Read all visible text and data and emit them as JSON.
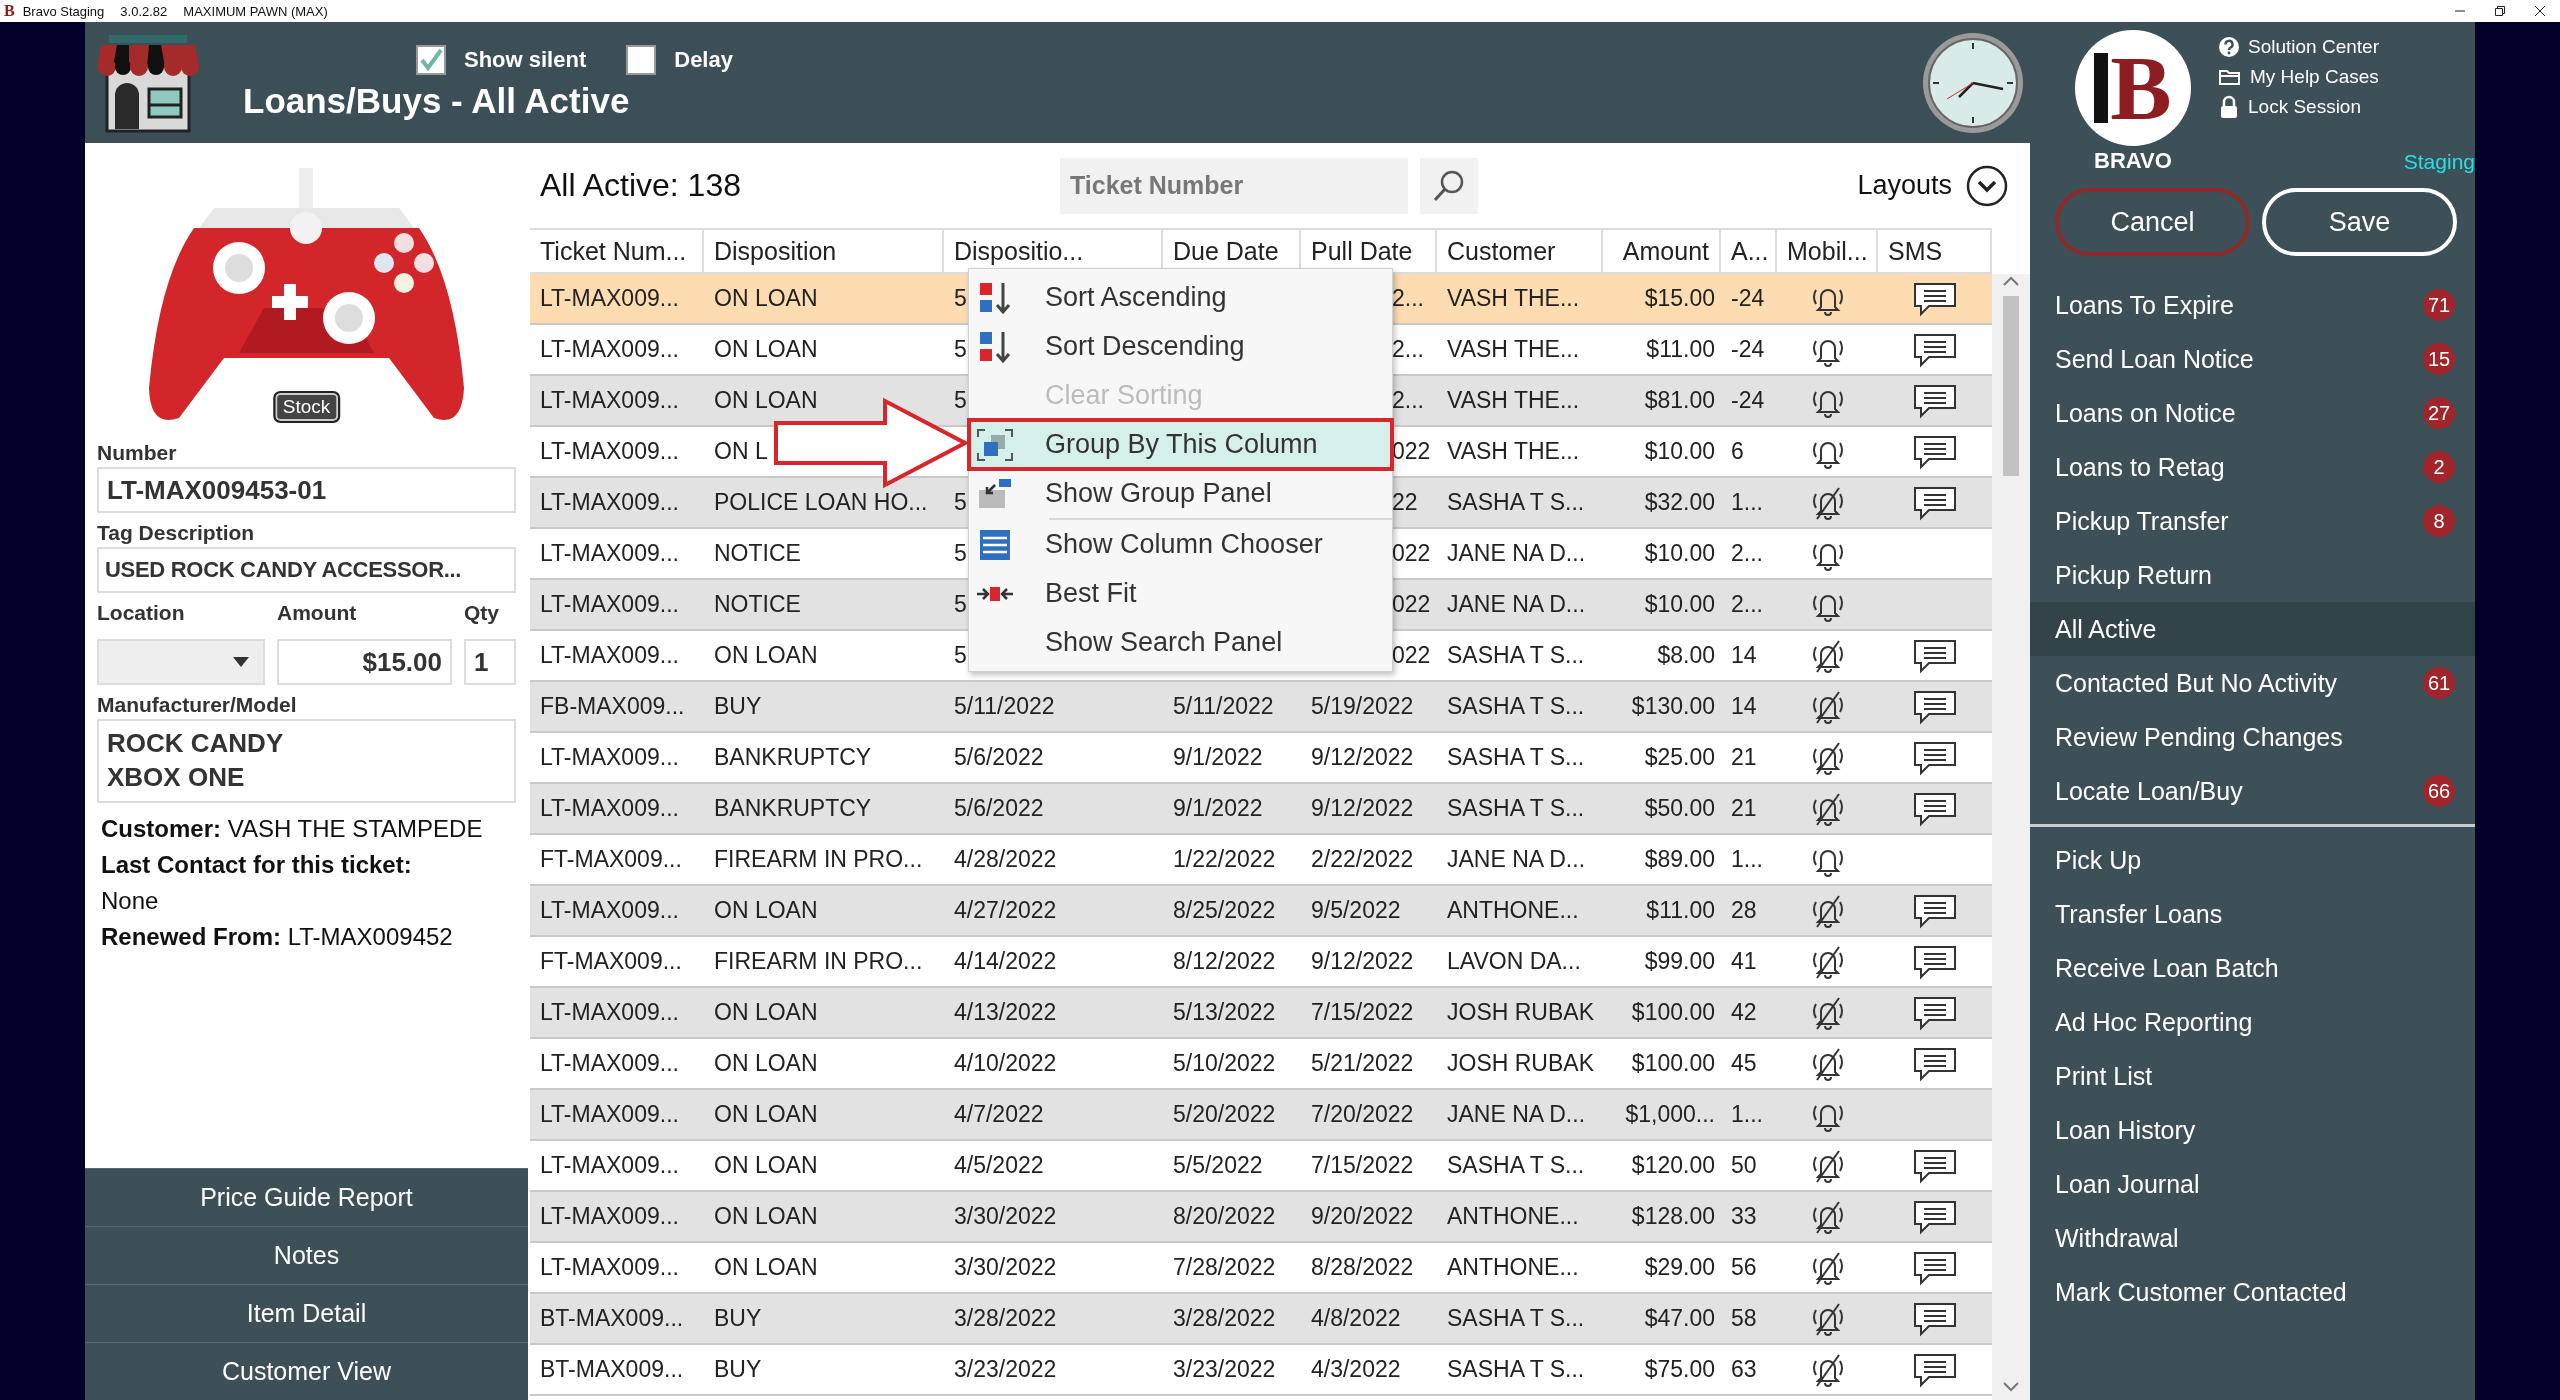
{
  "window": {
    "app_mark": "B",
    "title": "Bravo Staging",
    "version": "3.0.2.82",
    "store": "MAXIMUM PAWN (MAX)"
  },
  "header": {
    "options": [
      {
        "label": "Show silent",
        "checked": true
      },
      {
        "label": "Delay",
        "checked": false
      }
    ],
    "title": "Loans/Buys - All Active"
  },
  "brand": {
    "mark": "B",
    "name": "BRAVO",
    "environment": "Staging"
  },
  "help_links": [
    {
      "label": "Solution Center",
      "kind": "help"
    },
    {
      "label": "My Help Cases",
      "kind": "folder"
    },
    {
      "label": "Lock Session",
      "kind": "lock"
    }
  ],
  "actions": [
    {
      "label": "Cancel",
      "kind": "cancel"
    },
    {
      "label": "Save",
      "kind": "save"
    }
  ],
  "sidebar": {
    "sections": [
      {
        "items": [
          {
            "label": "Loans To Expire",
            "badge": "71",
            "selected": false
          },
          {
            "label": "Send Loan Notice",
            "badge": "15",
            "selected": false
          },
          {
            "label": "Loans on Notice",
            "badge": "27",
            "selected": false
          },
          {
            "label": "Loans to Retag",
            "badge": "2",
            "selected": false
          },
          {
            "label": "Pickup Transfer",
            "badge": "8",
            "selected": false
          },
          {
            "label": "Pickup Return",
            "selected": false
          },
          {
            "label": "All Active",
            "selected": true
          },
          {
            "label": "Contacted But No Activity",
            "badge": "61",
            "selected": false
          },
          {
            "label": "Review Pending Changes",
            "selected": false
          },
          {
            "label": "Locate Loan/Buy",
            "badge": "66",
            "selected": false
          }
        ]
      },
      {
        "items": [
          {
            "label": "Pick Up",
            "selected": false
          },
          {
            "label": "Transfer Loans",
            "selected": false
          },
          {
            "label": "Receive Loan Batch",
            "selected": false
          },
          {
            "label": "Ad Hoc Reporting",
            "selected": false
          },
          {
            "label": "Print List",
            "selected": false
          },
          {
            "label": "Loan History",
            "selected": false
          },
          {
            "label": "Loan Journal",
            "selected": false
          },
          {
            "label": "Withdrawal",
            "selected": false
          },
          {
            "label": "Mark Customer Contacted",
            "selected": false
          }
        ]
      }
    ]
  },
  "item": {
    "stock_badge": "Stock",
    "number": {
      "label": "Number",
      "value": "LT-MAX009453-01"
    },
    "tag_description": {
      "label": "Tag Description",
      "value": "USED ROCK CANDY ACCESSOR..."
    },
    "location": {
      "label": "Location"
    },
    "amount": {
      "label": "Amount",
      "value": "$15.00"
    },
    "qty": {
      "label": "Qty",
      "value": "1"
    },
    "manufacturer_model": {
      "label": "Manufacturer/Model",
      "value": "ROCK CANDY\nXBOX ONE"
    },
    "info": [
      {
        "text": "**Customer:** VASH THE STAMPEDE",
        "bold": false
      },
      {
        "text": "Last Contact for this ticket:",
        "bold": true
      },
      {
        "text": "None",
        "bold": false
      },
      {
        "text": "**Renewed From:** LT-MAX009452",
        "bold": false
      }
    ]
  },
  "left_buttons": [
    "Price Guide Report",
    "Notes",
    "Item Detail",
    "Customer View"
  ],
  "list": {
    "heading": "All Active: 138",
    "search": {
      "placeholder": "Ticket Number"
    },
    "layouts": "Layouts",
    "columns": [
      "Ticket Num...",
      "Disposition",
      "Dispositio...",
      "Due Date",
      "Pull Date",
      "Customer",
      "Amount",
      "A...",
      "Mobil...",
      "SMS"
    ],
    "rows": [
      {
        "ticket": "LT-MAX009...",
        "disposition": "ON LOAN",
        "disposition_date": "5",
        "pull_date": "2...",
        "customer": "VASH THE...",
        "amount": "$15.00",
        "column_8": "-24",
        "muted": false,
        "sms": true,
        "selected": true
      },
      {
        "ticket": "LT-MAX009...",
        "disposition": "ON LOAN",
        "disposition_date": "5",
        "pull_date": "2...",
        "customer": "VASH THE...",
        "amount": "$11.00",
        "column_8": "-24",
        "muted": false,
        "sms": true,
        "selected": false
      },
      {
        "ticket": "LT-MAX009...",
        "disposition": "ON LOAN",
        "disposition_date": "5",
        "pull_date": "2...",
        "customer": "VASH THE...",
        "amount": "$81.00",
        "column_8": "-24",
        "muted": false,
        "sms": true,
        "selected": false
      },
      {
        "ticket": "LT-MAX009...",
        "disposition": "ON L",
        "pull_date": "022",
        "customer": "VASH THE...",
        "amount": "$10.00",
        "column_8": "6",
        "muted": false,
        "sms": true,
        "selected": false
      },
      {
        "ticket": "LT-MAX009...",
        "disposition": "POLICE LOAN HO...",
        "disposition_date": "5",
        "pull_date": "22",
        "customer": "SASHA T S...",
        "amount": "$32.00",
        "column_8": "1...",
        "muted": true,
        "sms": true,
        "selected": false
      },
      {
        "ticket": "LT-MAX009...",
        "disposition": "NOTICE",
        "disposition_date": "5",
        "pull_date": "022",
        "customer": "JANE NA D...",
        "amount": "$10.00",
        "column_8": "2...",
        "muted": false,
        "sms": false,
        "selected": false
      },
      {
        "ticket": "LT-MAX009...",
        "disposition": "NOTICE",
        "disposition_date": "5",
        "pull_date": "022",
        "customer": "JANE NA D...",
        "amount": "$10.00",
        "column_8": "2...",
        "muted": false,
        "sms": false,
        "selected": false
      },
      {
        "ticket": "LT-MAX009...",
        "disposition": "ON LOAN",
        "disposition_date": "5",
        "pull_date": "022",
        "customer": "SASHA T S...",
        "amount": "$8.00",
        "column_8": "14",
        "muted": true,
        "sms": true,
        "selected": false
      },
      {
        "ticket": "FB-MAX009...",
        "disposition": "BUY",
        "disposition_date": "5/11/2022",
        "due_date": "5/11/2022",
        "pull_date": "5/19/2022",
        "customer": "SASHA T S...",
        "amount": "$130.00",
        "column_8": "14",
        "muted": true,
        "sms": true,
        "selected": false
      },
      {
        "ticket": "LT-MAX009...",
        "disposition": "BANKRUPTCY",
        "disposition_date": "5/6/2022",
        "due_date": "9/1/2022",
        "pull_date": "9/12/2022",
        "customer": "SASHA T S...",
        "amount": "$25.00",
        "column_8": "21",
        "muted": true,
        "sms": true,
        "selected": false
      },
      {
        "ticket": "LT-MAX009...",
        "disposition": "BANKRUPTCY",
        "disposition_date": "5/6/2022",
        "due_date": "9/1/2022",
        "pull_date": "9/12/2022",
        "customer": "SASHA T S...",
        "amount": "$50.00",
        "column_8": "21",
        "muted": true,
        "sms": true,
        "selected": false
      },
      {
        "ticket": "FT-MAX009...",
        "disposition": "FIREARM IN PRO...",
        "disposition_date": "4/28/2022",
        "due_date": "1/22/2022",
        "pull_date": "2/22/2022",
        "customer": "JANE NA D...",
        "amount": "$89.00",
        "column_8": "1...",
        "muted": false,
        "sms": false,
        "selected": false
      },
      {
        "ticket": "LT-MAX009...",
        "disposition": "ON LOAN",
        "disposition_date": "4/27/2022",
        "due_date": "8/25/2022",
        "pull_date": "9/5/2022",
        "customer": "ANTHONE...",
        "amount": "$11.00",
        "column_8": "28",
        "muted": true,
        "sms": true,
        "selected": false
      },
      {
        "ticket": "FT-MAX009...",
        "disposition": "FIREARM IN PRO...",
        "disposition_date": "4/14/2022",
        "due_date": "8/12/2022",
        "pull_date": "9/12/2022",
        "customer": "LAVON DA...",
        "amount": "$99.00",
        "column_8": "41",
        "muted": true,
        "sms": true,
        "selected": false
      },
      {
        "ticket": "LT-MAX009...",
        "disposition": "ON LOAN",
        "disposition_date": "4/13/2022",
        "due_date": "5/13/2022",
        "pull_date": "7/15/2022",
        "customer": "JOSH RUBAK",
        "amount": "$100.00",
        "column_8": "42",
        "muted": true,
        "sms": true,
        "selected": false
      },
      {
        "ticket": "LT-MAX009...",
        "disposition": "ON LOAN",
        "disposition_date": "4/10/2022",
        "due_date": "5/10/2022",
        "pull_date": "5/21/2022",
        "customer": "JOSH RUBAK",
        "amount": "$100.00",
        "column_8": "45",
        "muted": true,
        "sms": true,
        "selected": false
      },
      {
        "ticket": "LT-MAX009...",
        "disposition": "ON LOAN",
        "disposition_date": "4/7/2022",
        "due_date": "5/20/2022",
        "pull_date": "7/20/2022",
        "customer": "JANE NA D...",
        "amount": "$1,000...",
        "column_8": "1...",
        "muted": false,
        "sms": false,
        "selected": false
      },
      {
        "ticket": "LT-MAX009...",
        "disposition": "ON LOAN",
        "disposition_date": "4/5/2022",
        "due_date": "5/5/2022",
        "pull_date": "7/15/2022",
        "customer": "SASHA T S...",
        "amount": "$120.00",
        "column_8": "50",
        "muted": true,
        "sms": true,
        "selected": false
      },
      {
        "ticket": "LT-MAX009...",
        "disposition": "ON LOAN",
        "disposition_date": "3/30/2022",
        "due_date": "8/20/2022",
        "pull_date": "9/20/2022",
        "customer": "ANTHONE...",
        "amount": "$128.00",
        "column_8": "33",
        "muted": true,
        "sms": true,
        "selected": false
      },
      {
        "ticket": "LT-MAX009...",
        "disposition": "ON LOAN",
        "disposition_date": "3/30/2022",
        "due_date": "7/28/2022",
        "pull_date": "8/28/2022",
        "customer": "ANTHONE...",
        "amount": "$29.00",
        "column_8": "56",
        "muted": true,
        "sms": true,
        "selected": false
      },
      {
        "ticket": "BT-MAX009...",
        "disposition": "BUY",
        "disposition_date": "3/28/2022",
        "due_date": "3/28/2022",
        "pull_date": "4/8/2022",
        "customer": "SASHA T S...",
        "amount": "$47.00",
        "column_8": "58",
        "muted": true,
        "sms": true,
        "selected": false
      },
      {
        "ticket": "BT-MAX009...",
        "disposition": "BUY",
        "disposition_date": "3/23/2022",
        "due_date": "3/23/2022",
        "pull_date": "4/3/2022",
        "customer": "SASHA T S...",
        "amount": "$75.00",
        "column_8": "63",
        "muted": true,
        "sms": true,
        "selected": false
      }
    ]
  },
  "context_menu": {
    "items": [
      {
        "label": "Sort Ascending",
        "kind": "sort-asc",
        "disabled": false,
        "selected": false,
        "separator_before": false
      },
      {
        "label": "Sort Descending",
        "kind": "sort-desc",
        "disabled": false,
        "selected": false,
        "separator_before": false
      },
      {
        "label": "Clear Sorting",
        "kind": "plain",
        "disabled": true,
        "selected": false,
        "separator_before": false
      },
      {
        "label": "Group By This Column",
        "kind": "group",
        "disabled": false,
        "selected": true,
        "separator_before": false
      },
      {
        "label": "Show Group Panel",
        "kind": "group-panel",
        "disabled": false,
        "selected": false,
        "separator_before": false
      },
      {
        "label": "Show Column Chooser",
        "kind": "columns",
        "disabled": false,
        "selected": false,
        "separator_before": true
      },
      {
        "label": "Best Fit",
        "kind": "best-fit",
        "disabled": false,
        "selected": false,
        "separator_before": false
      },
      {
        "label": "Show Search Panel",
        "kind": "plain",
        "disabled": false,
        "selected": false,
        "separator_before": false
      }
    ]
  },
  "pointer_arrow": true
}
